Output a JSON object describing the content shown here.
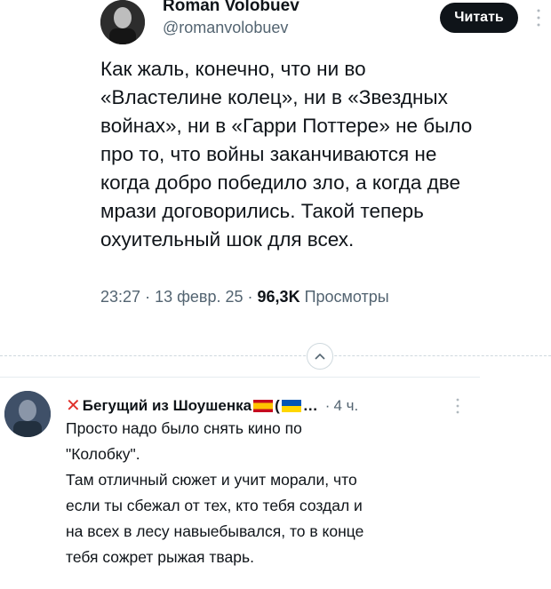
{
  "tweet": {
    "author_name": "Roman Volobuev",
    "author_handle": "@romanvolobuev",
    "follow_label": "Читать",
    "text": "Как жаль, конечно, что ни во\n«Властелине колец», ни в «Звездных\nвойнах», ни в «Гарри Поттере» не было\nпро то, что войны заканчиваются не\nкогда добро победило зло, а когда две\nмрази договорились. Такой теперь\nохуительный шок для всех.",
    "time": "23:27",
    "date": "13 февр. 25",
    "views_count": "96,3K",
    "views_label": "Просмотры"
  },
  "reply": {
    "author_name": "Бегущий из Шоушенка",
    "name_tail": "(",
    "ellipsis": "…",
    "time": "4 ч.",
    "text": "Просто надо было снять кино по\n\"Колобку\".\nТам отличный сюжет и учит морали, что\nесли ты сбежал от тех, кто тебя создал и\nна всех в лесу навыебывался, то в конце\nтебя сожрет рыжая тварь."
  },
  "icons": {
    "more": "more-vertical-icon",
    "collapse": "chevron-up-icon",
    "cross": "red-cross-icon",
    "flag_spain": "spain-flag-icon",
    "flag_ukraine": "ukraine-flag-icon"
  },
  "colors": {
    "text_primary": "#0f1419",
    "text_secondary": "#536471",
    "button_bg": "#0f1419",
    "cross_red": "#e0312b"
  }
}
